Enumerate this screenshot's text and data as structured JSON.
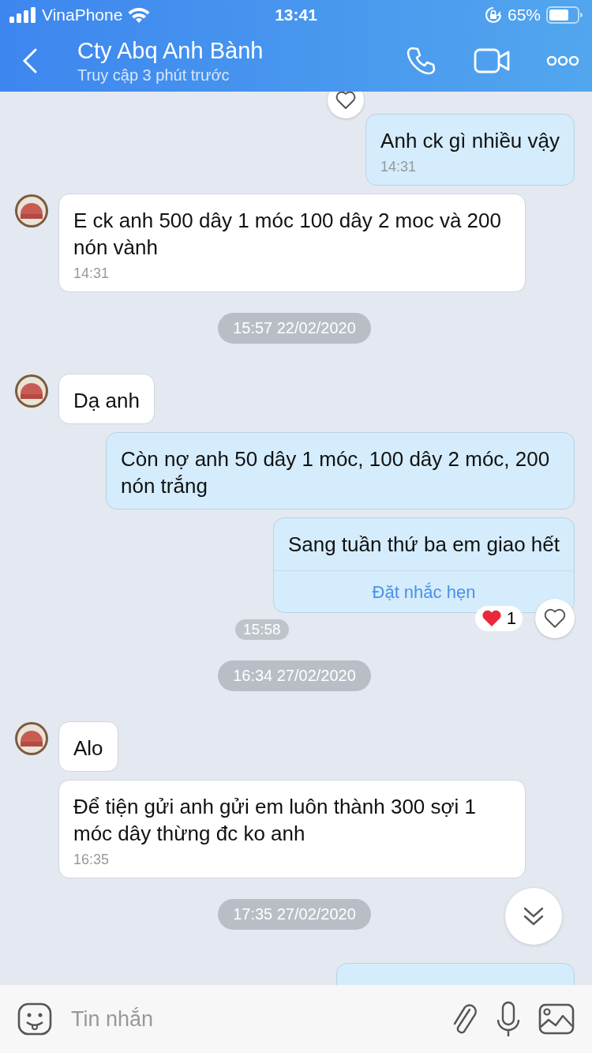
{
  "status_bar": {
    "carrier": "VinaPhone",
    "time": "13:41",
    "battery": "65%"
  },
  "header": {
    "title": "Cty Abq Anh Bành",
    "subtitle": "Truy cập 3 phút trước"
  },
  "messages": [
    {
      "kind": "outgoing",
      "text": "Anh ck gì nhiều vậy",
      "time": "14:31"
    },
    {
      "kind": "incoming",
      "avatar": true,
      "text": "E ck anh 500 dây 1 móc 100 dây 2 moc và 200 nón vành",
      "time": "14:31"
    },
    {
      "kind": "date",
      "text": "15:57 22/02/2020"
    },
    {
      "kind": "incoming",
      "avatar": true,
      "text": "Dạ anh"
    },
    {
      "kind": "outgoing",
      "text": "Còn nợ anh 50 dây 1 móc, 100 dây 2 móc, 200 nón trắng"
    },
    {
      "kind": "outgoing",
      "text": "Sang tuần thứ ba em giao hết",
      "action": "Đặt nhắc hẹn",
      "time": "15:58",
      "reaction_count": "1"
    },
    {
      "kind": "date",
      "text": "16:34 27/02/2020"
    },
    {
      "kind": "incoming",
      "avatar": true,
      "text": "Alo"
    },
    {
      "kind": "incoming",
      "avatar": false,
      "text": "Để tiện gửi anh gửi em luôn thành 300 sợi 1 móc dây thừng đc ko anh",
      "time": "16:35"
    },
    {
      "kind": "date",
      "text": "17:35 27/02/2020"
    }
  ],
  "composer": {
    "placeholder": "Tin nhắn"
  }
}
